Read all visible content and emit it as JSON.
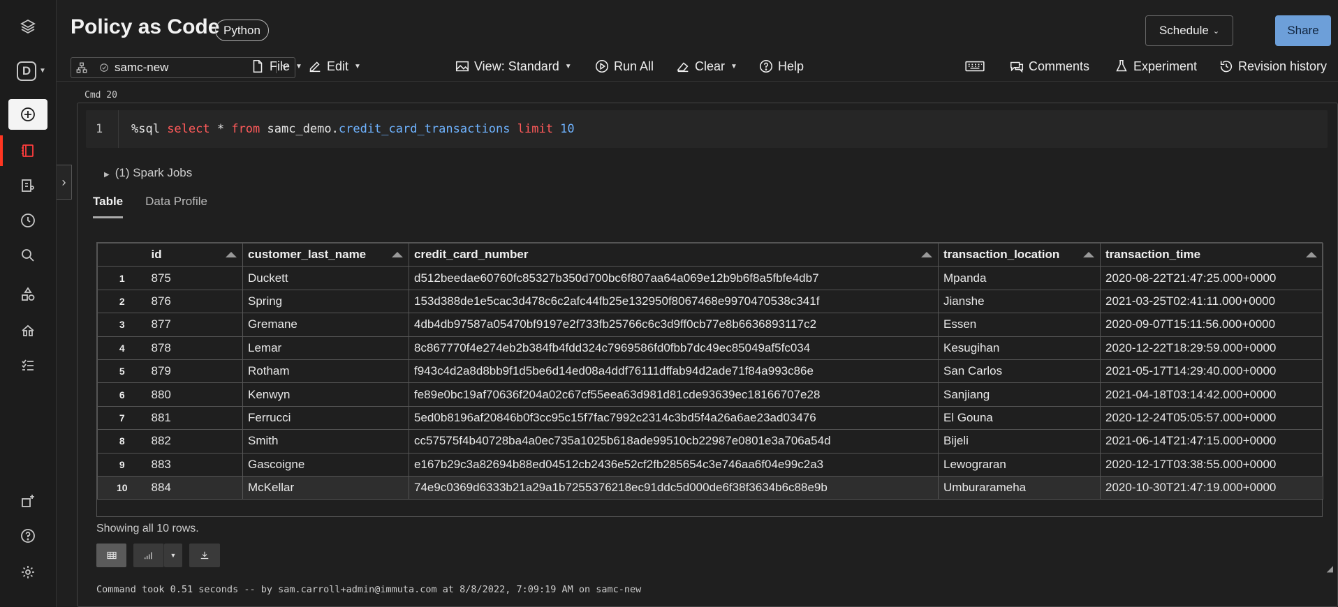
{
  "header": {
    "title": "Policy as Code",
    "language": "Python",
    "schedule_label": "Schedule",
    "share_label": "Share"
  },
  "toolbar": {
    "cluster_name": "samc-new",
    "file_label": "File",
    "edit_label": "Edit",
    "view_label": "View: Standard",
    "run_all_label": "Run All",
    "clear_label": "Clear",
    "help_label": "Help",
    "comments_label": "Comments",
    "experiment_label": "Experiment",
    "revision_label": "Revision history"
  },
  "sidebar": {
    "workspace_letter": "D",
    "icons": [
      "layers-icon",
      "create-icon",
      "notebook-icon",
      "repos-icon",
      "recents-icon",
      "search-icon",
      "data-icon",
      "models-icon",
      "jobs-icon",
      "partner-icon",
      "help-icon",
      "settings-icon"
    ]
  },
  "cell": {
    "cmd_label": "Cmd 20",
    "line_number": "1",
    "code": {
      "magic": "%sql ",
      "select": "select",
      "star": " * ",
      "from": "from",
      "table_prefix": " samc_demo.",
      "table_name": "credit_card_transactions",
      "limit": " limit",
      "limit_value": " 10"
    },
    "spark_jobs": "(1) Spark Jobs",
    "tabs": [
      "Table",
      "Data Profile"
    ],
    "showing": "Showing all 10 rows.",
    "footer": "Command took 0.51 seconds -- by sam.carroll+admin@immuta.com at 8/8/2022, 7:09:19 AM on samc-new"
  },
  "table": {
    "columns": [
      "id",
      "customer_last_name",
      "credit_card_number",
      "transaction_location",
      "transaction_time"
    ],
    "rows": [
      [
        "1",
        "875",
        "Duckett",
        "d512beedae60760fc85327b350d700bc6f807aa64a069e12b9b6f8a5fbfe4db7",
        "Mpanda",
        "2020-08-22T21:47:25.000+0000"
      ],
      [
        "2",
        "876",
        "Spring",
        "153d388de1e5cac3d478c6c2afc44fb25e132950f8067468e9970470538c341f",
        "Jianshe",
        "2021-03-25T02:41:11.000+0000"
      ],
      [
        "3",
        "877",
        "Gremane",
        "4db4db97587a05470bf9197e2f733fb25766c6c3d9ff0cb77e8b6636893117c2",
        "Essen",
        "2020-09-07T15:11:56.000+0000"
      ],
      [
        "4",
        "878",
        "Lemar",
        "8c867770f4e274eb2b384fb4fdd324c7969586fd0fbb7dc49ec85049af5fc034",
        "Kesugihan",
        "2020-12-22T18:29:59.000+0000"
      ],
      [
        "5",
        "879",
        "Rotham",
        "f943c4d2a8d8bb9f1d5be6d14ed08a4ddf76111dffab94d2ade71f84a993c86e",
        "San Carlos",
        "2021-05-17T14:29:40.000+0000"
      ],
      [
        "6",
        "880",
        "Kenwyn",
        "fe89e0bc19af70636f204a02c67cf55eea63d981d81cde93639ec18166707e28",
        "Sanjiang",
        "2021-04-18T03:14:42.000+0000"
      ],
      [
        "7",
        "881",
        "Ferrucci",
        "5ed0b8196af20846b0f3cc95c15f7fac7992c2314c3bd5f4a26a6ae23ad03476",
        "El Gouna",
        "2020-12-24T05:05:57.000+0000"
      ],
      [
        "8",
        "882",
        "Smith",
        "cc57575f4b40728ba4a0ec735a1025b618ade99510cb22987e0801e3a706a54d",
        "Bijeli",
        "2021-06-14T21:47:15.000+0000"
      ],
      [
        "9",
        "883",
        "Gascoigne",
        "e167b29c3a82694b88ed04512cb2436e52cf2fb285654c3e746aa6f04e99c2a3",
        "Lewograran",
        "2020-12-17T03:38:55.000+0000"
      ],
      [
        "10",
        "884",
        "McKellar",
        "74e9c0369d6333b21a29a1b7255376218ec91ddc5d000de6f38f3634b6c88e9b",
        "Umburarameha",
        "2020-10-30T21:47:19.000+0000"
      ]
    ]
  }
}
